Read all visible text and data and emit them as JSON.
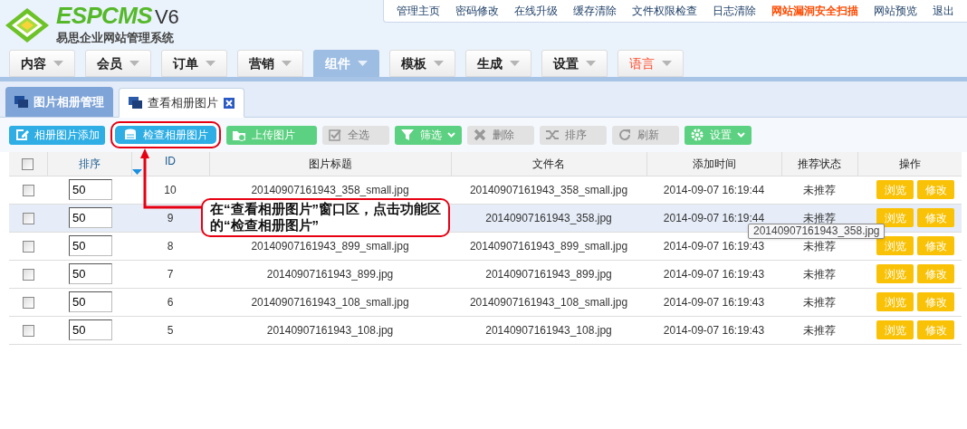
{
  "brand": {
    "name": "ESPCMS",
    "version": "V6",
    "subtitle": "易思企业网站管理系统"
  },
  "top_links": [
    {
      "label": "管理主页",
      "highlight": false
    },
    {
      "label": "密码修改",
      "highlight": false
    },
    {
      "label": "在线升级",
      "highlight": false
    },
    {
      "label": "缓存清除",
      "highlight": false
    },
    {
      "label": "文件权限检查",
      "highlight": false
    },
    {
      "label": "日志清除",
      "highlight": false
    },
    {
      "label": "网站漏洞安全扫描",
      "highlight": true
    },
    {
      "label": "网站预览",
      "highlight": false
    },
    {
      "label": "退出",
      "highlight": false
    }
  ],
  "nav": [
    {
      "label": "内容",
      "selected": false,
      "highlight": false
    },
    {
      "label": "会员",
      "selected": false,
      "highlight": false
    },
    {
      "label": "订单",
      "selected": false,
      "highlight": false
    },
    {
      "label": "营销",
      "selected": false,
      "highlight": false
    },
    {
      "label": "组件",
      "selected": true,
      "highlight": false
    },
    {
      "label": "模板",
      "selected": false,
      "highlight": false
    },
    {
      "label": "生成",
      "selected": false,
      "highlight": false
    },
    {
      "label": "设置",
      "selected": false,
      "highlight": false
    },
    {
      "label": "语言",
      "selected": false,
      "highlight": true
    }
  ],
  "tabs": [
    {
      "label": "图片相册管理",
      "selected": false,
      "closable": false
    },
    {
      "label": "查看相册图片",
      "selected": true,
      "closable": true
    }
  ],
  "toolbar": [
    {
      "label": "相册图片添加",
      "kind": "primary",
      "dropdown": false,
      "circled": false
    },
    {
      "label": "检查相册图片",
      "kind": "primary",
      "dropdown": false,
      "circled": true
    },
    {
      "label": "上传图片",
      "kind": "success",
      "dropdown": false,
      "circled": false
    },
    {
      "label": "全选",
      "kind": "disabled",
      "dropdown": false,
      "circled": false
    },
    {
      "label": "筛选",
      "kind": "success",
      "dropdown": true,
      "circled": false
    },
    {
      "label": "删除",
      "kind": "disabled",
      "dropdown": false,
      "circled": false
    },
    {
      "label": "排序",
      "kind": "disabled",
      "dropdown": false,
      "circled": false
    },
    {
      "label": "刷新",
      "kind": "disabled",
      "dropdown": false,
      "circled": false
    },
    {
      "label": "设置",
      "kind": "success",
      "dropdown": true,
      "circled": false
    }
  ],
  "table": {
    "all_checked": false,
    "columns": [
      "排序",
      "ID",
      "图片标题",
      "文件名",
      "添加时间",
      "推荐状态",
      "操作"
    ],
    "rows": [
      {
        "checked": false,
        "selected": false,
        "order": "50",
        "id": "10",
        "title": "20140907161943_358_small.jpg",
        "file": "20140907161943_358_small.jpg",
        "time": "2014-09-07 16:19:44",
        "status": "未推荐",
        "actions": [
          "浏览",
          "修改"
        ]
      },
      {
        "checked": false,
        "selected": true,
        "order": "50",
        "id": "9",
        "file": "20140907161943_358.jpg",
        "time": "2014-09-07 16:19:44",
        "status": "未推荐",
        "actions": [
          "浏览",
          "修改"
        ]
      },
      {
        "checked": false,
        "selected": false,
        "order": "50",
        "id": "8",
        "title": "20140907161943_899_small.jpg",
        "file": "20140907161943_899_small.jpg",
        "time": "2014-09-07 16:19:43",
        "status": "未推荐",
        "actions": [
          "浏览",
          "修改"
        ]
      },
      {
        "checked": false,
        "selected": false,
        "order": "50",
        "id": "7",
        "title": "20140907161943_899.jpg",
        "file": "20140907161943_899.jpg",
        "time": "2014-09-07 16:19:43",
        "status": "未推荐",
        "actions": [
          "浏览",
          "修改"
        ]
      },
      {
        "checked": false,
        "selected": false,
        "order": "50",
        "id": "6",
        "title": "20140907161943_108_small.jpg",
        "file": "20140907161943_108_small.jpg",
        "time": "2014-09-07 16:19:43",
        "status": "未推荐",
        "actions": [
          "浏览",
          "修改"
        ]
      },
      {
        "checked": false,
        "selected": false,
        "order": "50",
        "id": "5",
        "title": "20140907161943_108.jpg",
        "file": "20140907161943_108.jpg",
        "time": "2014-09-07 16:19:43",
        "status": "未推荐",
        "actions": [
          "浏览",
          "修改"
        ]
      }
    ]
  },
  "tooltip": "20140907161943_358.jpg",
  "callout": "在“查看相册图片”窗口区，点击功能区的“检查相册图片”"
}
